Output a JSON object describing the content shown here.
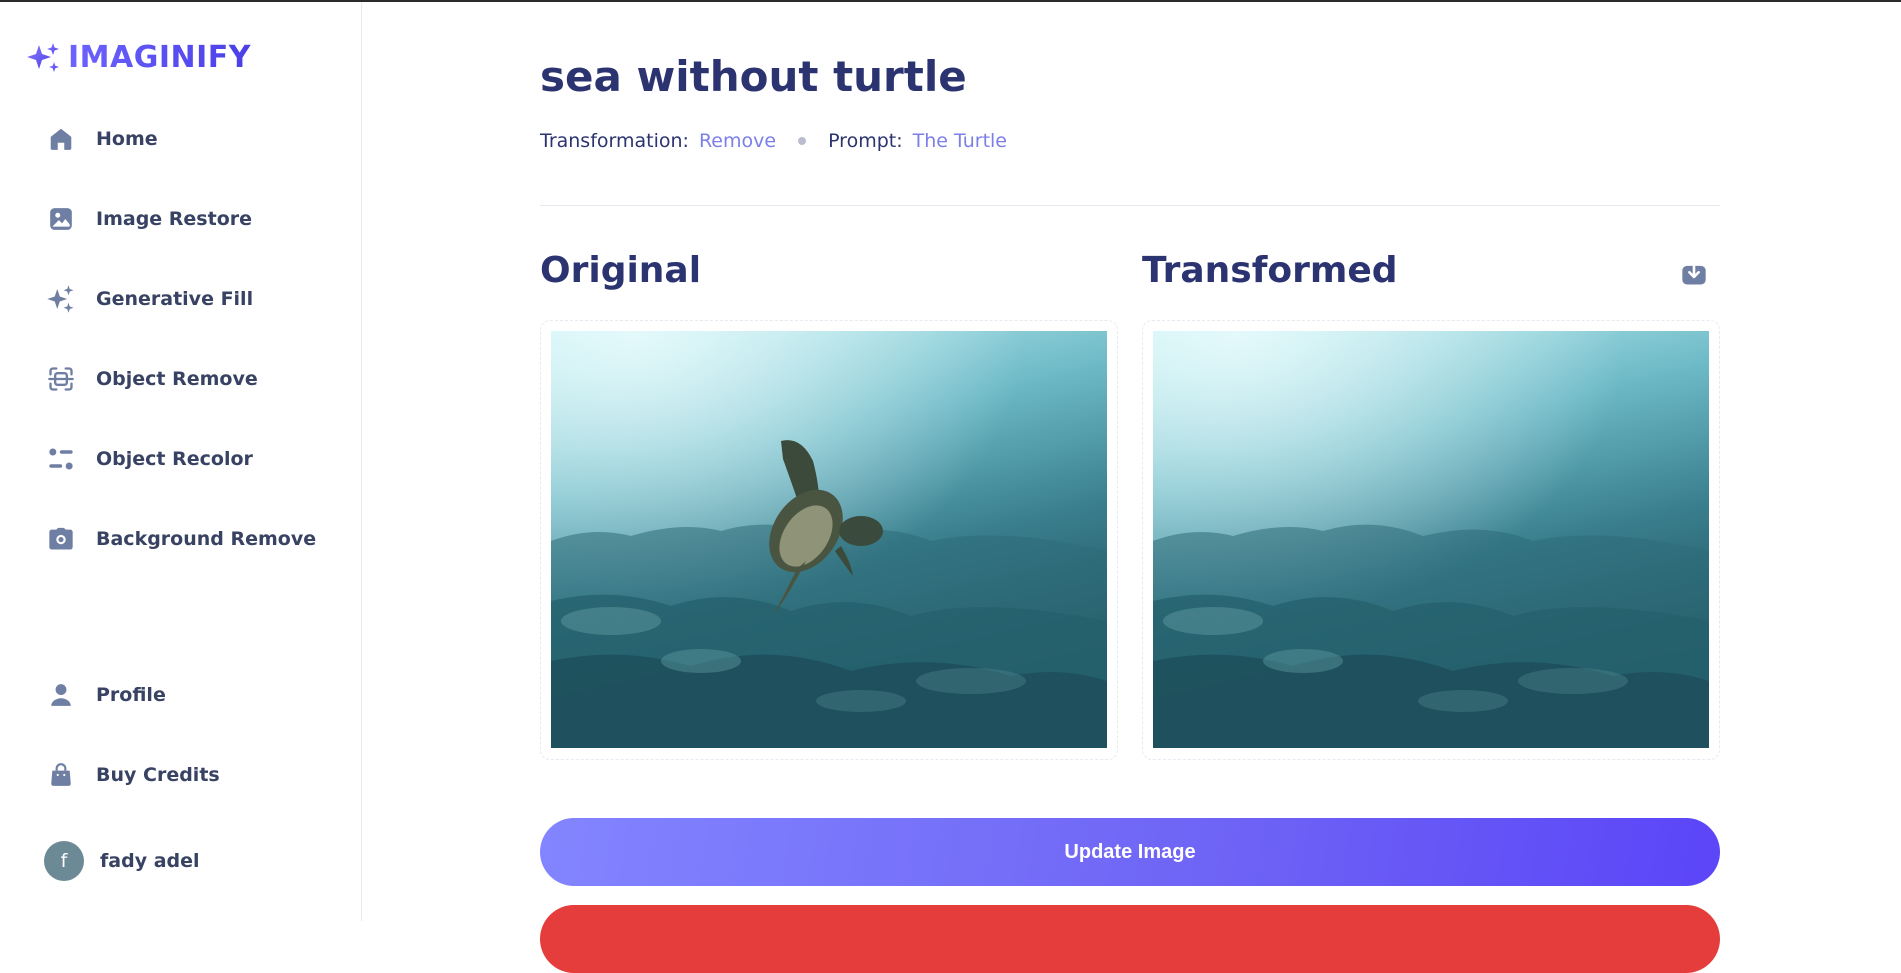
{
  "app": {
    "name": "IMAGINIFY"
  },
  "sidebar": {
    "items": [
      {
        "label": "Home",
        "icon": "home-icon"
      },
      {
        "label": "Image Restore",
        "icon": "image-icon"
      },
      {
        "label": "Generative Fill",
        "icon": "sparkles-icon"
      },
      {
        "label": "Object Remove",
        "icon": "scan-icon"
      },
      {
        "label": "Object Recolor",
        "icon": "filter-icon"
      },
      {
        "label": "Background Remove",
        "icon": "camera-icon"
      }
    ],
    "bottom_items": [
      {
        "label": "Profile",
        "icon": "user-icon"
      },
      {
        "label": "Buy Credits",
        "icon": "bag-icon"
      }
    ],
    "user": {
      "initial": "f",
      "name": "fady adel"
    }
  },
  "page": {
    "title": "sea without turtle",
    "transformation_key": "Transformation:",
    "transformation_value": "Remove",
    "prompt_key": "Prompt:",
    "prompt_value": "The Turtle",
    "original_label": "Original",
    "transformed_label": "Transformed",
    "update_button": "Update Image"
  },
  "colors": {
    "brand": "#6c63ff",
    "heading": "#2b3470",
    "accent_text": "#7c7fe8",
    "icon": "#6f7fa3",
    "delete": "#e53c3c"
  }
}
